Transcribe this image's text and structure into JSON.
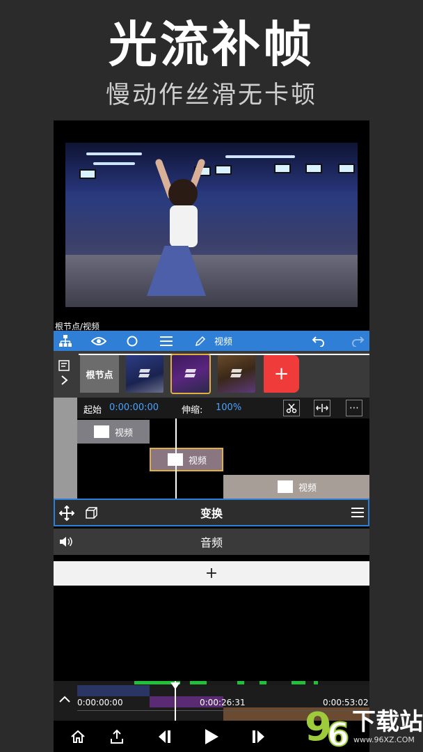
{
  "promo": {
    "headline": "光流补帧",
    "subline": "慢动作丝滑无卡顿"
  },
  "path_label": "根节点/视频",
  "toolbar": {
    "node_icon": "node-tree-icon",
    "eye_icon": "eye-icon",
    "circle_icon": "circle-icon",
    "menu_icon": "menu-icon",
    "edit_icon": "pencil-icon",
    "label": "视频",
    "undo_icon": "undo-icon",
    "redo_icon": "redo-icon"
  },
  "nodes": {
    "root_label": "根节点",
    "add_label": "+"
  },
  "timeline": {
    "start_label": "起始",
    "start_value": "0:00:00:00",
    "stretch_label": "伸缩:",
    "stretch_value": "100%",
    "clips": [
      {
        "label": "视频"
      },
      {
        "label": "视频"
      },
      {
        "label": "视频"
      }
    ]
  },
  "transform_bar": {
    "label": "变换"
  },
  "audio_bar": {
    "label": "音频"
  },
  "add_bar": {
    "label": "+"
  },
  "bottom_timeline": {
    "t0": "0:00:00:00",
    "t1": "0:00:26:31",
    "t2": "0:00:53:02"
  },
  "watermark": {
    "brand": "下载站",
    "domain": "www.96XZ.COM"
  },
  "colors": {
    "accent": "#2f7fd6",
    "add_red": "#f03b3b",
    "selected_clip": "#e0b040"
  }
}
